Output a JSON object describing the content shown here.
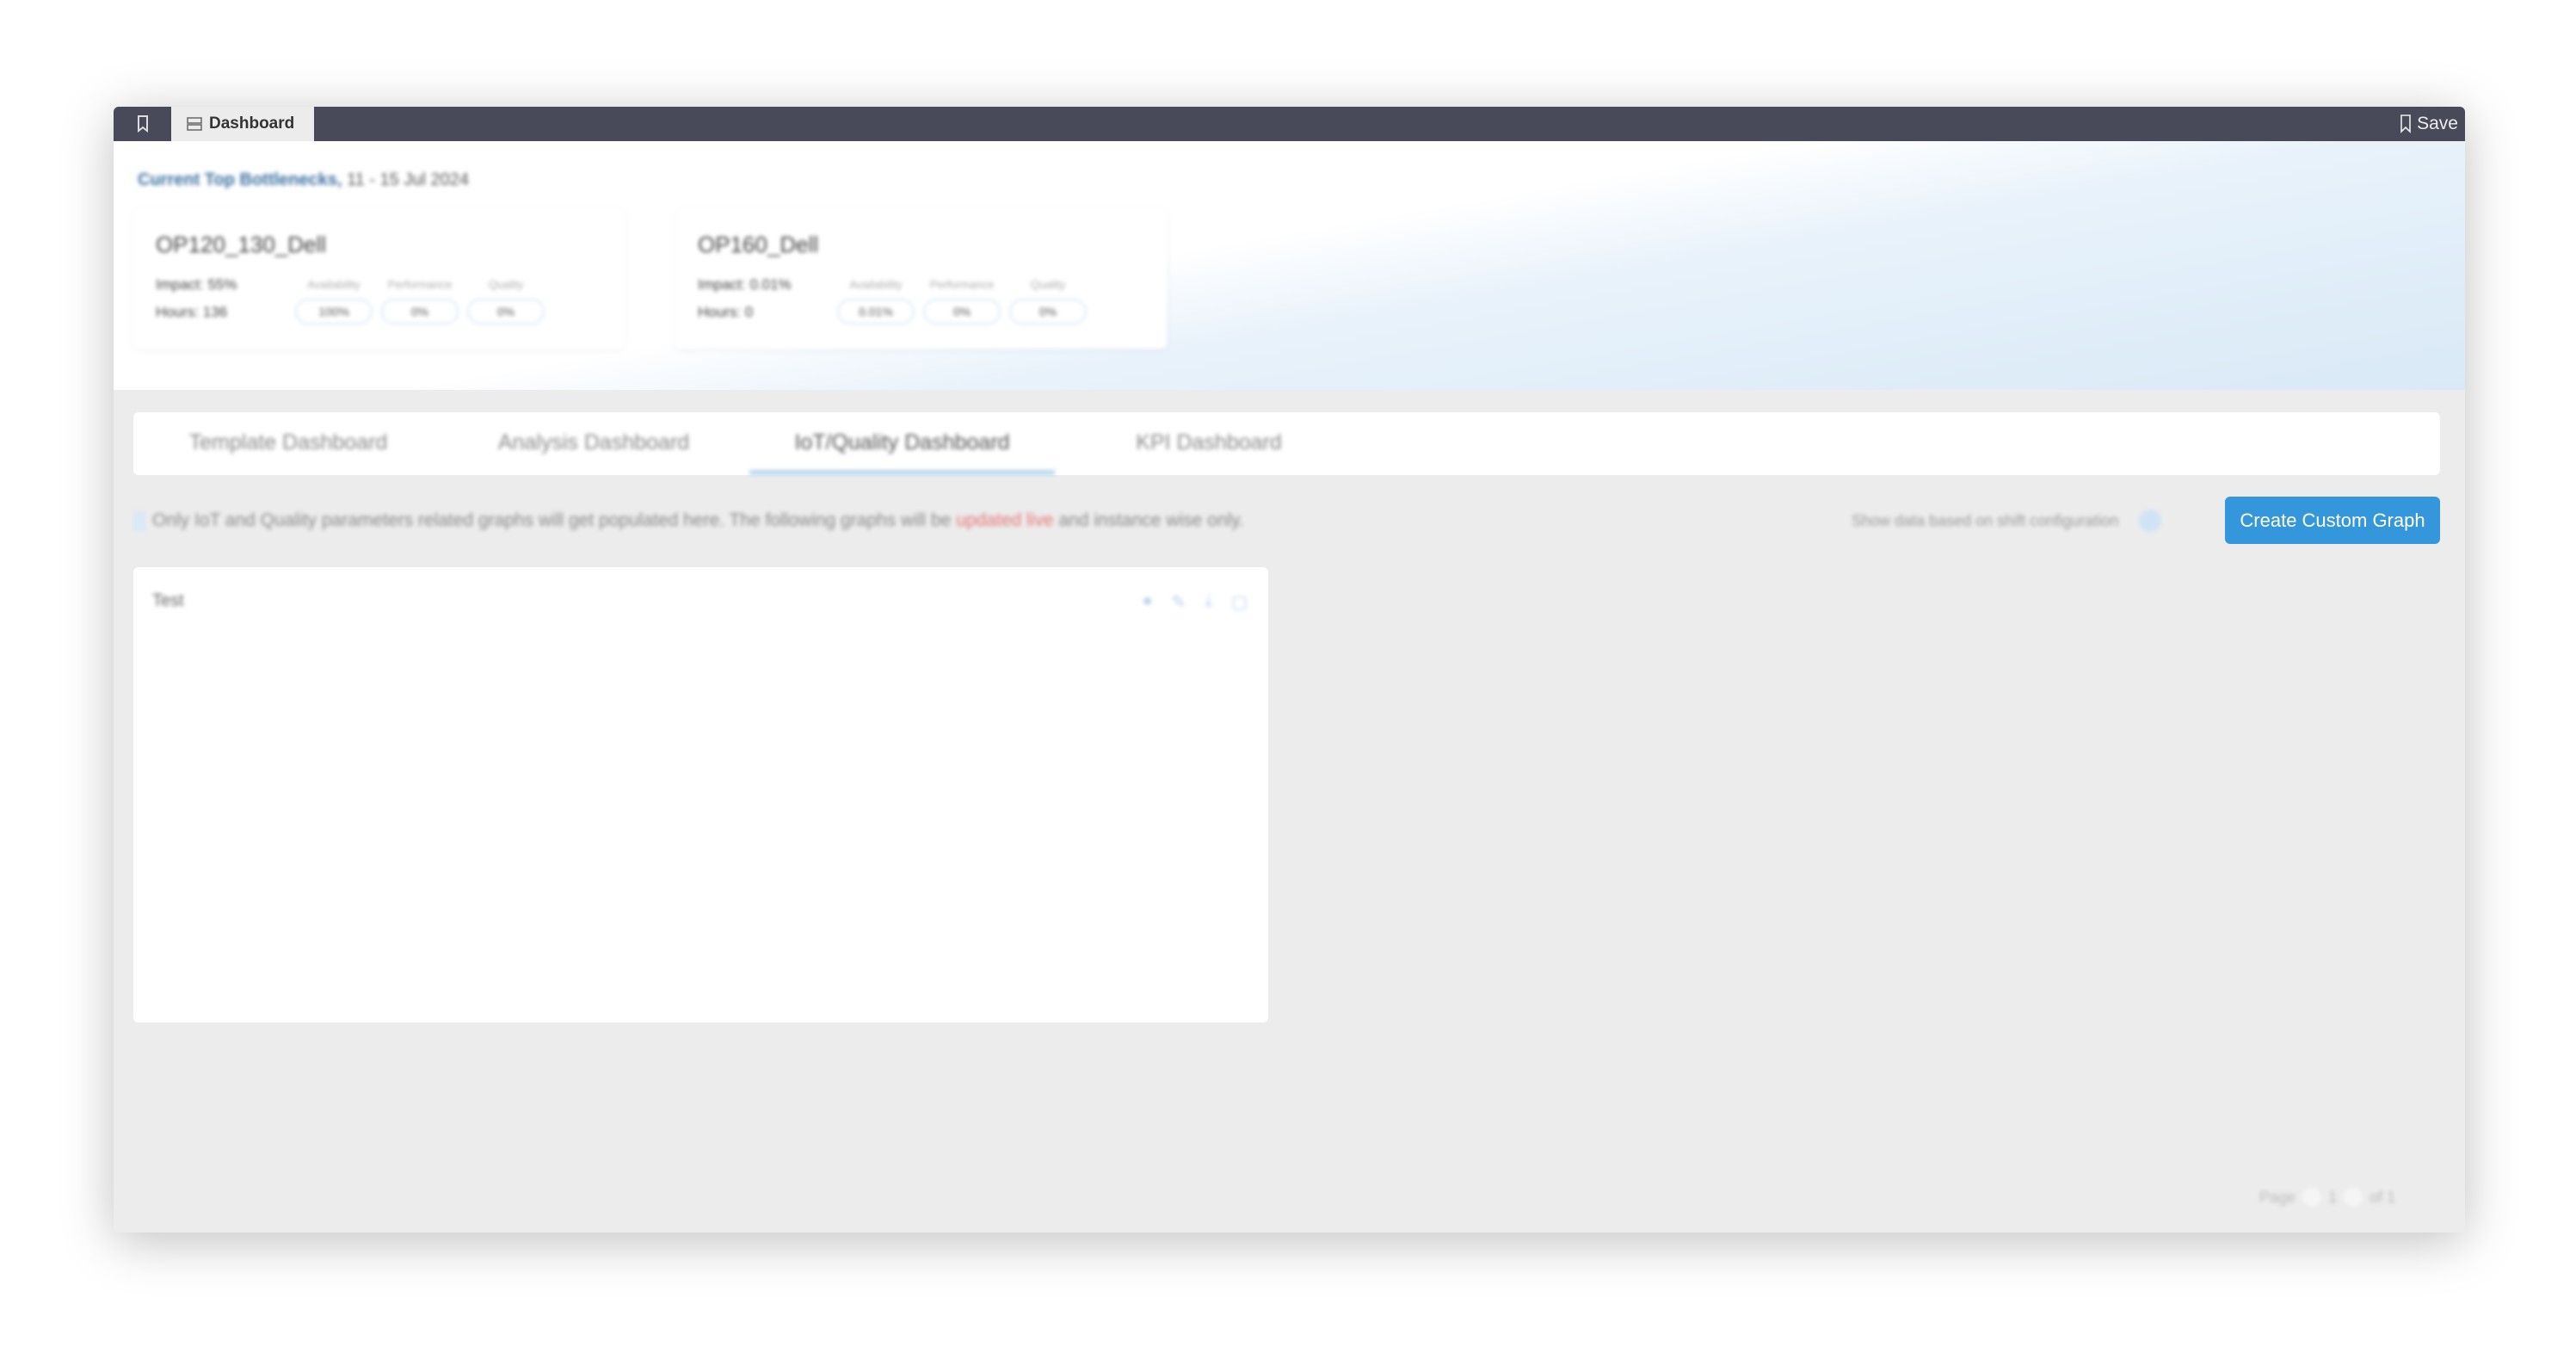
{
  "titlebar": {
    "tab_label": "Dashboard",
    "save_label": "Save"
  },
  "header": {
    "title": "Current Top Bottlenecks,",
    "date_range": "11 - 15 Jul 2024",
    "cards": [
      {
        "name": "OP120_130_Dell",
        "impact": "Impact: 55%",
        "hours": "Hours: 136",
        "metric_labels": [
          "Availability",
          "Performance",
          "Quality"
        ],
        "metric_values": [
          "100%",
          "0%",
          "0%"
        ]
      },
      {
        "name": "OP160_Dell",
        "impact": "Impact: 0.01%",
        "hours": "Hours: 0",
        "metric_labels": [
          "Availability",
          "Performance",
          "Quality"
        ],
        "metric_values": [
          "0.01%",
          "0%",
          "0%"
        ]
      }
    ]
  },
  "tabs": [
    "Template Dashboard",
    "Analysis Dashboard",
    "IoT/Quality Dashboard",
    "KPI Dashboard"
  ],
  "info": {
    "text_before": "Only IoT and Quality parameters related graphs will get populated here. The following graphs will be",
    "highlight": "updated live",
    "text_after": "and instance wise only."
  },
  "config_label": "Show data based on shift configuration",
  "create_button": "Create Custom Graph",
  "graph": {
    "title": "Test"
  },
  "pager": {
    "label": "Page",
    "current": "1",
    "total": "of 1"
  }
}
